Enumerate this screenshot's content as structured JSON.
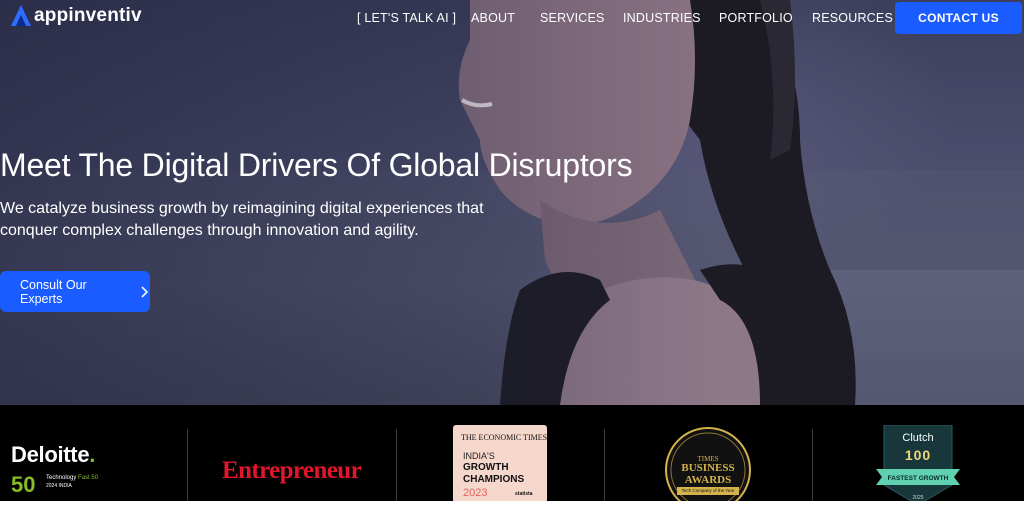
{
  "brand": {
    "name": "appinventiv",
    "accent": "#1a5cff"
  },
  "nav": {
    "items": [
      "[ LET'S TALK AI ]",
      "ABOUT",
      "SERVICES",
      "INDUSTRIES",
      "PORTFOLIO",
      "RESOURCES"
    ],
    "cta": "CONTACT US"
  },
  "hero": {
    "headline": "Meet The Digital Drivers Of Global Disruptors",
    "subtext": "We catalyze business growth by reimagining digital experiences that conquer complex challenges through innovation and agility.",
    "cta": "Consult Our Experts",
    "cta_icon": "chevron-right-icon"
  },
  "awards": {
    "deloitte": {
      "name": "Deloitte",
      "dot": ".",
      "number": "50",
      "line1_prefix": "Technology ",
      "line1_highlight": "Fast 50",
      "line2": "2024  INDIA"
    },
    "entrepreneur": {
      "name": "Entrepreneur"
    },
    "economic_times": {
      "masthead": "THE ECONOMIC TIMES",
      "line1": "INDIA'S",
      "line2": "GROWTH",
      "line3": "CHAMPIONS",
      "year": "2023",
      "brand": "statista"
    },
    "times_business": {
      "line1": "TIMES",
      "line2": "BUSINESS",
      "line3": "AWARDS",
      "ribbon": "Tech Company of the Year"
    },
    "clutch": {
      "name": "Clutch",
      "number": "100",
      "ribbon": "FASTEST GROWTH",
      "year": "2025"
    }
  }
}
